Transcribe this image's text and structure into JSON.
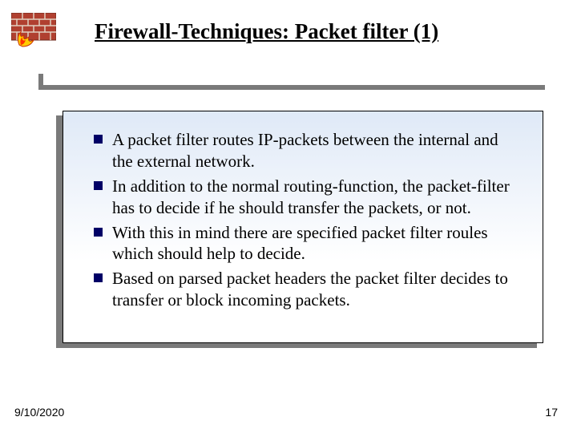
{
  "title": "Firewall-Techniques: Packet filter (1)",
  "bullets": {
    "items": [
      "A packet filter routes IP-packets between the internal and the external network.",
      "In addition to the normal routing-function, the packet-filter has to decide if he should transfer the packets, or not.",
      "With this in mind there are specified packet filter roules which should help to decide.",
      "Based on parsed packet headers the packet filter decides to transfer or block incoming packets."
    ]
  },
  "footer": {
    "date": "9/10/2020",
    "page": "17"
  }
}
